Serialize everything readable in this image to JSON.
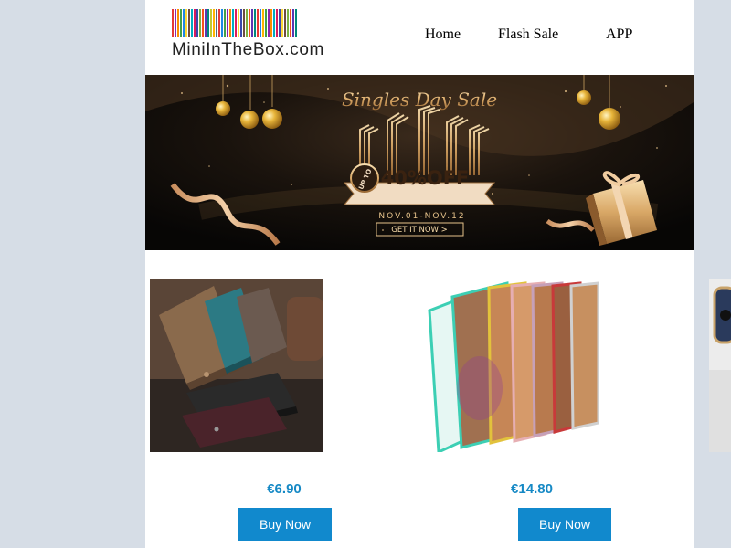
{
  "header": {
    "logo_text": "MiniInTheBox.com",
    "logo_bar_colors": [
      "#e53935",
      "#8e24aa",
      "#fb8c00",
      "#43a047",
      "#1e88e5",
      "#fdd835",
      "#6d4c41",
      "#00acc1",
      "#d81b60",
      "#3949ab",
      "#7cb342",
      "#f4511e",
      "#5e35b1",
      "#00897b",
      "#c0ca33",
      "#ffb300",
      "#546e7a",
      "#e53935",
      "#1e88e5",
      "#43a047",
      "#8e24aa",
      "#fb8c00",
      "#00acc1",
      "#d81b60",
      "#fdd835",
      "#3949ab",
      "#6d4c41",
      "#7cb342",
      "#f4511e",
      "#5e35b1",
      "#00897b",
      "#e53935",
      "#1e88e5",
      "#ffb300",
      "#43a047",
      "#8e24aa",
      "#fb8c00",
      "#00acc1",
      "#d81b60",
      "#3949ab",
      "#fdd835",
      "#6d4c41",
      "#7cb342",
      "#f4511e",
      "#5e35b1",
      "#00897b"
    ],
    "nav": [
      {
        "label": "Home"
      },
      {
        "label": "Flash Sale"
      },
      {
        "label": "APP"
      }
    ]
  },
  "banner": {
    "headline": "Singles Day Sale",
    "badge_prefix": "UP TO",
    "discount": "40%OFF",
    "dates": "NOV.01-NOV.12",
    "cta": "GET IT NOW >"
  },
  "products": [
    {
      "price": "€6.90",
      "button": "Buy Now",
      "image": "wallet-phone-cases"
    },
    {
      "price": "€14.80",
      "button": "Buy Now",
      "image": "clear-bumper-phone-cases"
    }
  ],
  "colors": {
    "page_bg": "#d6dde6",
    "accent": "#1189cd",
    "price": "#1689c5"
  }
}
